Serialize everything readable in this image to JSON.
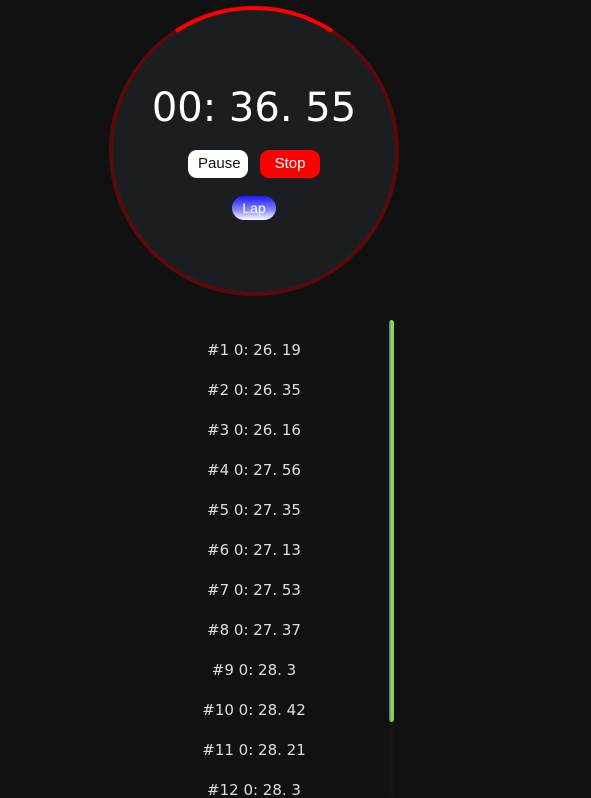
{
  "stopwatch": {
    "time": "00: 36. 55",
    "progress": 0.18,
    "colors": {
      "face": "#1b1e21",
      "ring_track": "#5a0a0a",
      "ring_progress": "#ff0000"
    },
    "pause_label": "Pause",
    "stop_label": "Stop",
    "lap_label": "Lap"
  },
  "laps": [
    "#1 0: 26. 19",
    "#2 0: 26. 35",
    "#3 0: 26. 16",
    "#4 0: 27. 56",
    "#5 0: 27. 35",
    "#6 0: 27. 13",
    "#7 0: 27. 53",
    "#8 0: 27. 37",
    "#9 0: 28. 3",
    "#10 0: 28. 42",
    "#11 0: 28. 21",
    "#12 0: 28. 3"
  ],
  "scrollbar": {
    "thumb_colors": [
      "#3f6fb0",
      "#8fd14f"
    ]
  }
}
